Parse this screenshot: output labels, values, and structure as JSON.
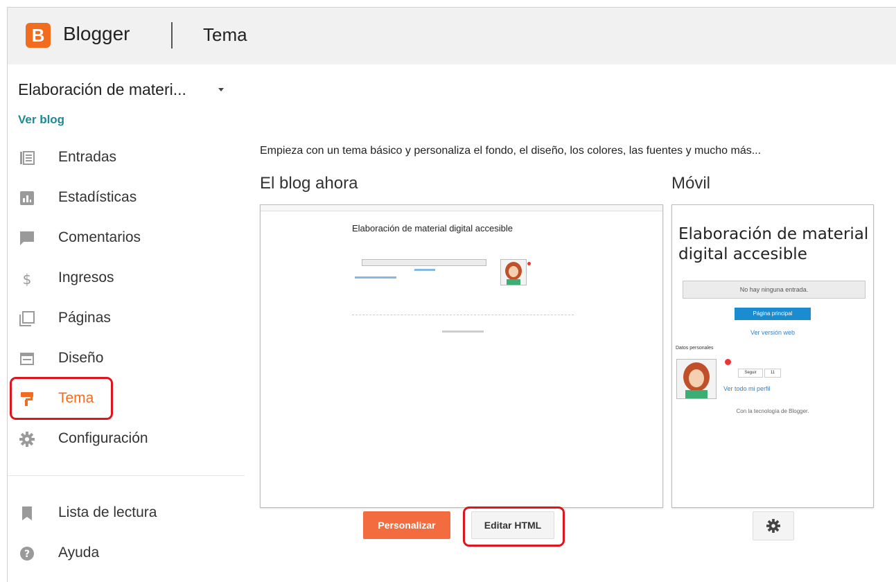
{
  "header": {
    "logo_letter": "B",
    "brand": "Blogger",
    "section": "Tema",
    "brand_color": "#f26c1f"
  },
  "sidebar": {
    "blog_name": "Elaboración de materi...",
    "view_blog": "Ver blog",
    "items": [
      {
        "label": "Entradas",
        "icon": "posts-icon"
      },
      {
        "label": "Estadísticas",
        "icon": "stats-icon"
      },
      {
        "label": "Comentarios",
        "icon": "comments-icon"
      },
      {
        "label": "Ingresos",
        "icon": "dollar-icon"
      },
      {
        "label": "Páginas",
        "icon": "pages-icon"
      },
      {
        "label": "Diseño",
        "icon": "layout-icon"
      },
      {
        "label": "Tema",
        "icon": "paint-roller-icon",
        "active": true
      },
      {
        "label": "Configuración",
        "icon": "gear-icon"
      }
    ],
    "bottom_items": [
      {
        "label": "Lista de lectura",
        "icon": "bookmark-icon"
      },
      {
        "label": "Ayuda",
        "icon": "help-icon"
      }
    ]
  },
  "main": {
    "intro": "Empieza con un tema básico y personaliza el fondo, el diseño, los colores, las fuentes y mucho más...",
    "current_title": "El blog ahora",
    "mobile_title": "Móvil",
    "preview": {
      "blog_title": "Elaboración de material digital accesible"
    },
    "mobile_preview": {
      "blog_title": "Elaboración de material digital accesible",
      "empty_text": "No hay ninguna entrada.",
      "home_button": "Página principal",
      "web_link": "Ver versión web",
      "personal_data": "Datos personales",
      "follow_label": "Seguir",
      "follow_count": "11",
      "profile_link": "Ver todo mi perfil",
      "powered_by": "Con la tecnología de Blogger."
    },
    "buttons": {
      "customize": "Personalizar",
      "edit_html": "Editar HTML"
    }
  },
  "colors": {
    "accent": "#f26c1f",
    "highlight_box": "#e0141c",
    "link": "#1a8a96"
  }
}
